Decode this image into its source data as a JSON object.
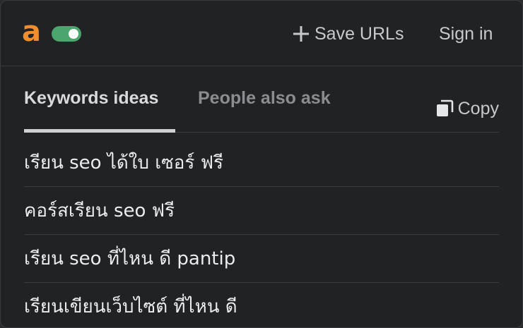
{
  "header": {
    "logo": "a",
    "toggle_on": true,
    "save_urls_label": "Save URLs",
    "sign_in_label": "Sign in"
  },
  "tabs": [
    {
      "label": "Keywords ideas",
      "active": true
    },
    {
      "label": "People also ask",
      "active": false
    }
  ],
  "copy_label": "Copy",
  "keywords": [
    "เรียน seo ได้ใบ เซอร์ ฟรี",
    "คอร์สเรียน seo ฟรี",
    "เรียน seo ที่ไหน ดี pantip",
    "เรียนเขียนเว็บไซต์ ที่ไหน ดี"
  ],
  "colors": {
    "accent_logo": "#f08d2c",
    "toggle_on": "#4ca46e",
    "panel_bg": "#212224"
  },
  "icons": [
    "plus-icon",
    "copy-icon"
  ]
}
